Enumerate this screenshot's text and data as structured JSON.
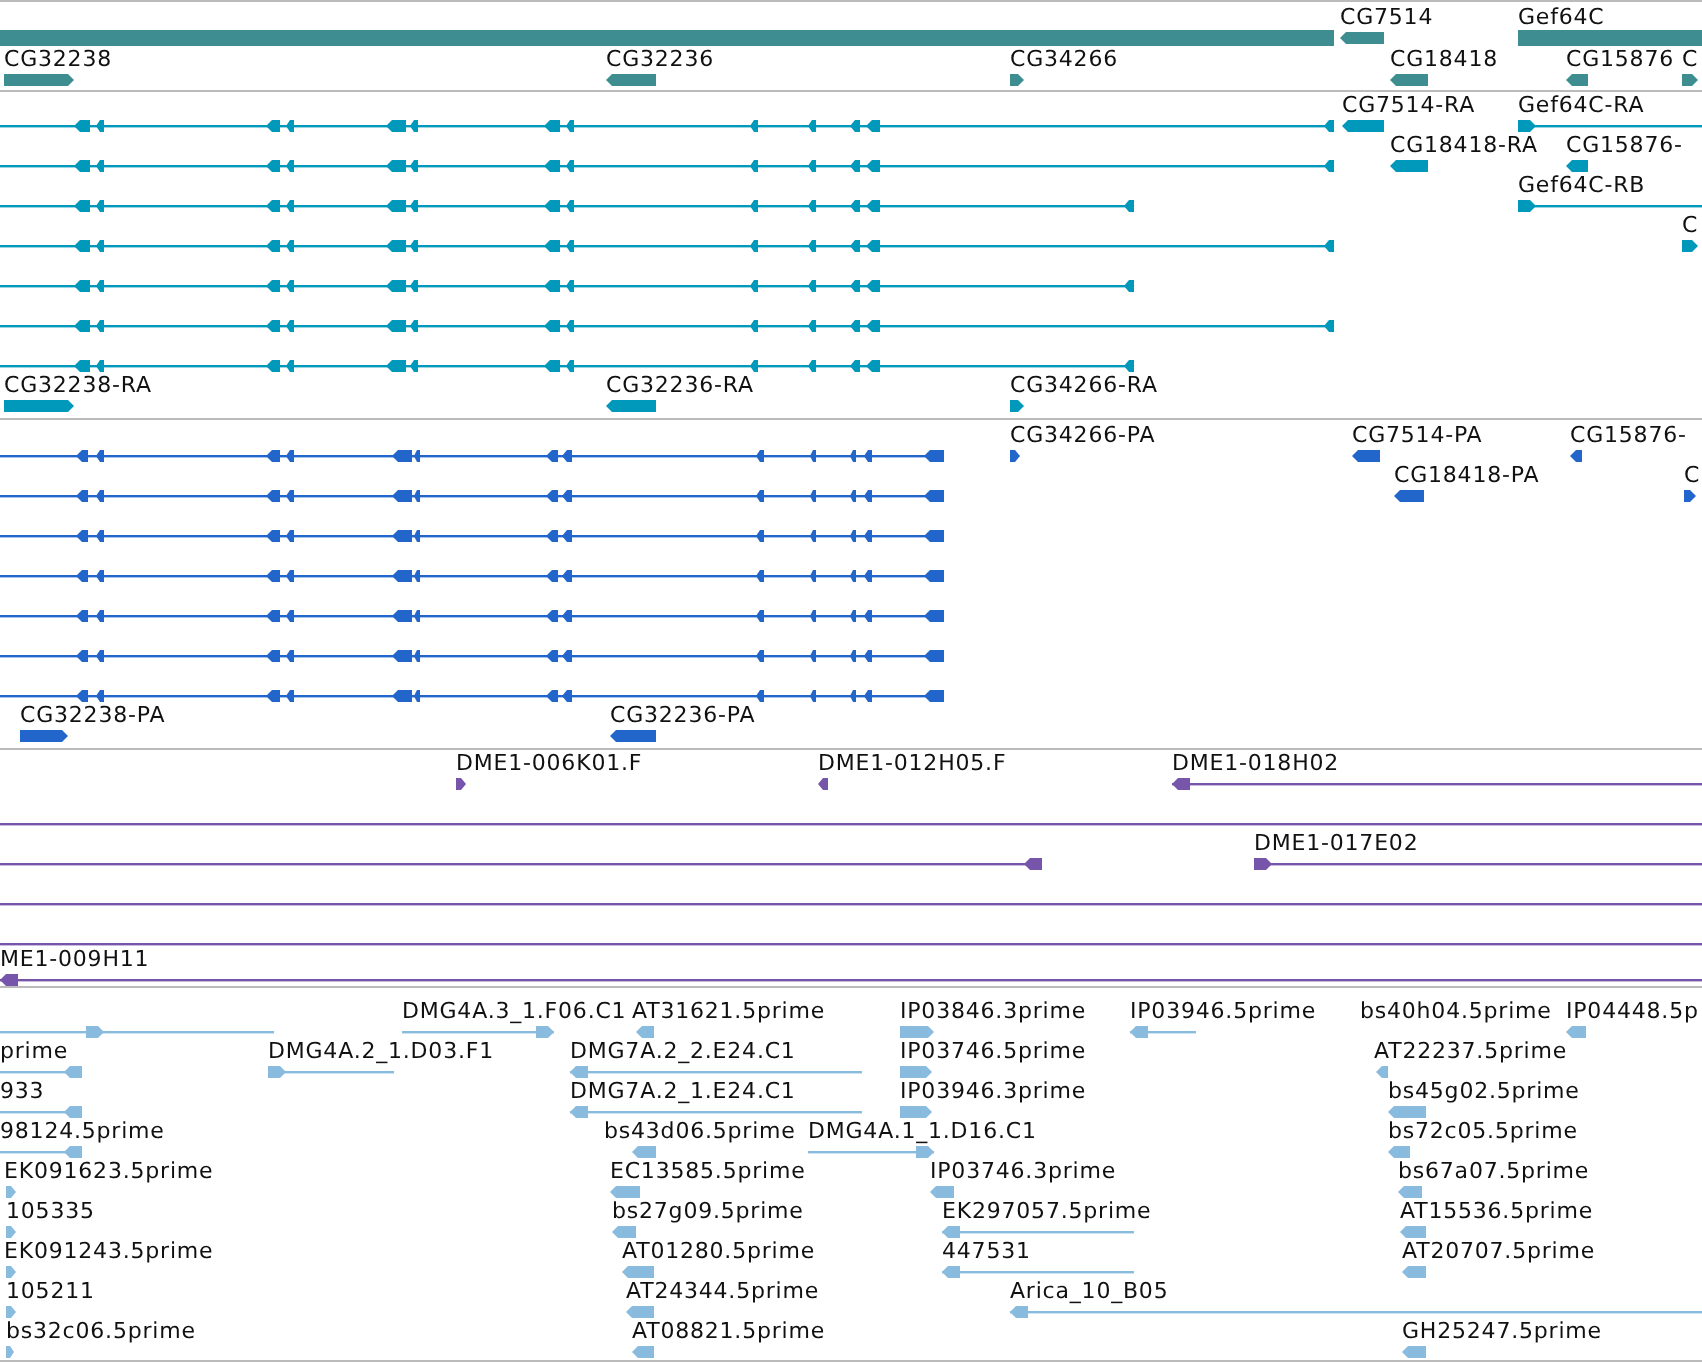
{
  "tracks": [
    {
      "kind": "gene",
      "features": [
        {
          "kind": "bar"
        },
        {
          "kind": "arrow",
          "label": "CG7514",
          "reverse": true
        },
        {
          "kind": "bar",
          "label": "Gef64C"
        },
        {
          "kind": "arrow",
          "label": "CG32238",
          "reverse": false
        },
        {
          "kind": "arrow",
          "label": "CG32236",
          "reverse": true
        },
        {
          "kind": "arrow",
          "label": "CG34266",
          "reverse": false
        },
        {
          "kind": "arrow",
          "label": "CG18418",
          "reverse": true
        },
        {
          "kind": "arrow",
          "label": "CG15876",
          "reverse": true
        },
        {
          "kind": "arrow",
          "label": "C",
          "reverse": false
        }
      ]
    },
    {
      "kind": "transcript",
      "features": [
        {
          "kind": "transcript",
          "reverse": true
        },
        {
          "kind": "transcript",
          "reverse": true
        },
        {
          "kind": "transcript",
          "reverse": true
        },
        {
          "kind": "transcript",
          "reverse": true
        },
        {
          "kind": "transcript",
          "reverse": true
        },
        {
          "kind": "transcript",
          "reverse": true
        },
        {
          "kind": "transcript",
          "reverse": true
        },
        {
          "kind": "arrow",
          "label": "CG7514-RA",
          "reverse": true
        },
        {
          "kind": "line",
          "label": "Gef64C-RA",
          "reverse": false
        },
        {
          "kind": "arrow",
          "label": "CG18418-RA",
          "reverse": true
        },
        {
          "kind": "arrow",
          "label": "CG15876-",
          "reverse": true
        },
        {
          "kind": "line",
          "label": "Gef64C-RB",
          "reverse": false
        },
        {
          "kind": "arrow",
          "label": "C",
          "reverse": false
        },
        {
          "kind": "arrow",
          "label": "CG32238-RA",
          "reverse": false
        },
        {
          "kind": "arrow",
          "label": "CG32236-RA",
          "reverse": true
        },
        {
          "kind": "arrow",
          "label": "CG34266-RA",
          "reverse": false
        }
      ]
    },
    {
      "kind": "cds",
      "features": [
        {
          "kind": "transcript",
          "reverse": true
        },
        {
          "kind": "transcript",
          "reverse": true
        },
        {
          "kind": "transcript",
          "reverse": true
        },
        {
          "kind": "transcript",
          "reverse": true
        },
        {
          "kind": "transcript",
          "reverse": true
        },
        {
          "kind": "transcript",
          "reverse": true
        },
        {
          "kind": "transcript",
          "reverse": true
        },
        {
          "kind": "arrow",
          "label": "CG34266-PA",
          "reverse": false
        },
        {
          "kind": "arrow",
          "label": "CG7514-PA",
          "reverse": true
        },
        {
          "kind": "arrow",
          "label": "CG15876-",
          "reverse": true
        },
        {
          "kind": "arrow",
          "label": "CG18418-PA",
          "reverse": true
        },
        {
          "kind": "arrow",
          "label": "C",
          "reverse": false
        },
        {
          "kind": "arrow",
          "label": "CG32238-PA",
          "reverse": false
        },
        {
          "kind": "arrow",
          "label": "CG32236-PA",
          "reverse": true
        }
      ]
    },
    {
      "kind": "est",
      "features": [
        {
          "kind": "arrow",
          "label": "DME1-006K01.F",
          "reverse": false
        },
        {
          "kind": "arrow",
          "label": "DME1-012H05.F",
          "reverse": true
        },
        {
          "kind": "line",
          "label": "DME1-018H02",
          "reverse": true
        },
        {
          "kind": "line"
        },
        {
          "kind": "line",
          "reverse": true
        },
        {
          "kind": "line",
          "label": "DME1-017E02",
          "reverse": false
        },
        {
          "kind": "line"
        },
        {
          "kind": "line"
        },
        {
          "kind": "line",
          "label": "ME1-009H11",
          "reverse": true
        }
      ]
    },
    {
      "kind": "cdna",
      "features": [
        {
          "kind": "line",
          "reverse": false
        },
        {
          "kind": "line",
          "label": "DMG4A.3_1.F06.C1",
          "reverse": false
        },
        {
          "kind": "arrow",
          "label": "AT31621.5prime",
          "reverse": true
        },
        {
          "kind": "arrow",
          "label": "IP03846.3prime",
          "reverse": false
        },
        {
          "kind": "line",
          "label": "IP03946.5prime",
          "reverse": true
        },
        {
          "kind": "label",
          "label": "bs40h04.5prime"
        },
        {
          "kind": "arrow",
          "label": "IP04448.5p",
          "reverse": true
        },
        {
          "kind": "line",
          "label": "prime",
          "reverse": true
        },
        {
          "kind": "line",
          "label": "DMG4A.2_1.D03.F1",
          "reverse": false
        },
        {
          "kind": "line",
          "label": "DMG7A.2_2.E24.C1",
          "reverse": true
        },
        {
          "kind": "arrow",
          "label": "IP03746.5prime",
          "reverse": false
        },
        {
          "kind": "arrow",
          "label": "AT22237.5prime",
          "reverse": true
        },
        {
          "kind": "line",
          "label": "933",
          "reverse": true
        },
        {
          "kind": "line",
          "label": "DMG7A.2_1.E24.C1",
          "reverse": true
        },
        {
          "kind": "arrow",
          "label": "IP03946.3prime",
          "reverse": false
        },
        {
          "kind": "arrow",
          "label": "bs45g02.5prime",
          "reverse": true
        },
        {
          "kind": "line",
          "label": "98124.5prime",
          "reverse": true
        },
        {
          "kind": "arrow",
          "label": "bs43d06.5prime",
          "reverse": true
        },
        {
          "kind": "line",
          "label": "DMG4A.1_1.D16.C1",
          "reverse": false
        },
        {
          "kind": "arrow",
          "label": "bs72c05.5prime",
          "reverse": true
        },
        {
          "kind": "arrow",
          "label": "EK091623.5prime",
          "reverse": false
        },
        {
          "kind": "arrow",
          "label": "EC13585.5prime",
          "reverse": true
        },
        {
          "kind": "arrow",
          "label": "IP03746.3prime",
          "reverse": true
        },
        {
          "kind": "arrow",
          "label": "bs67a07.5prime",
          "reverse": true
        },
        {
          "kind": "arrow",
          "label": "105335",
          "reverse": false
        },
        {
          "kind": "arrow",
          "label": "bs27g09.5prime",
          "reverse": true
        },
        {
          "kind": "line",
          "label": "EK297057.5prime",
          "reverse": true
        },
        {
          "kind": "arrow",
          "label": "AT15536.5prime",
          "reverse": true
        },
        {
          "kind": "arrow",
          "label": "EK091243.5prime",
          "reverse": false
        },
        {
          "kind": "arrow",
          "label": "AT01280.5prime",
          "reverse": true
        },
        {
          "kind": "line",
          "label": "447531",
          "reverse": true
        },
        {
          "kind": "arrow",
          "label": "AT20707.5prime",
          "reverse": true
        },
        {
          "kind": "arrow",
          "label": "105211",
          "reverse": false
        },
        {
          "kind": "arrow",
          "label": "AT24344.5prime",
          "reverse": true
        },
        {
          "kind": "line",
          "label": "Arica_10_B05",
          "reverse": true
        },
        {
          "kind": "arrow",
          "label": "bs32c06.5prime",
          "reverse": false
        },
        {
          "kind": "arrow",
          "label": "AT08821.5prime",
          "reverse": true
        },
        {
          "kind": "arrow",
          "label": "GH25247.5prime",
          "reverse": true
        }
      ]
    }
  ]
}
